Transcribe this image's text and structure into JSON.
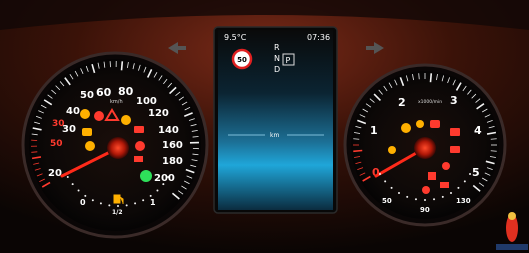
{
  "display": {
    "outside_temp": "9.5°C",
    "clock": "07:36",
    "speed_limit": "50",
    "gear_letters": [
      "R",
      "N",
      "D"
    ],
    "gear_selected": "P",
    "odometer_unit": "km"
  },
  "speedometer": {
    "unit": "km/h",
    "labels": [
      "20",
      "30",
      "40",
      "50",
      "60",
      "80",
      "100",
      "120",
      "140",
      "160",
      "180",
      "200"
    ]
  },
  "tachometer": {
    "unit": "x1000/min",
    "labels": [
      "1",
      "2",
      "3",
      "4",
      "5"
    ]
  },
  "fuel_gauge": {
    "labels": [
      "0",
      "1/2",
      "1"
    ]
  },
  "temp_gauge": {
    "labels": [
      "50",
      "90",
      "130"
    ]
  },
  "colors": {
    "accent_red": "#ff3a2e",
    "warning_amber": "#ffb000",
    "indicator_green": "#2ee05a",
    "screen_blue": "#1fa6d9"
  }
}
